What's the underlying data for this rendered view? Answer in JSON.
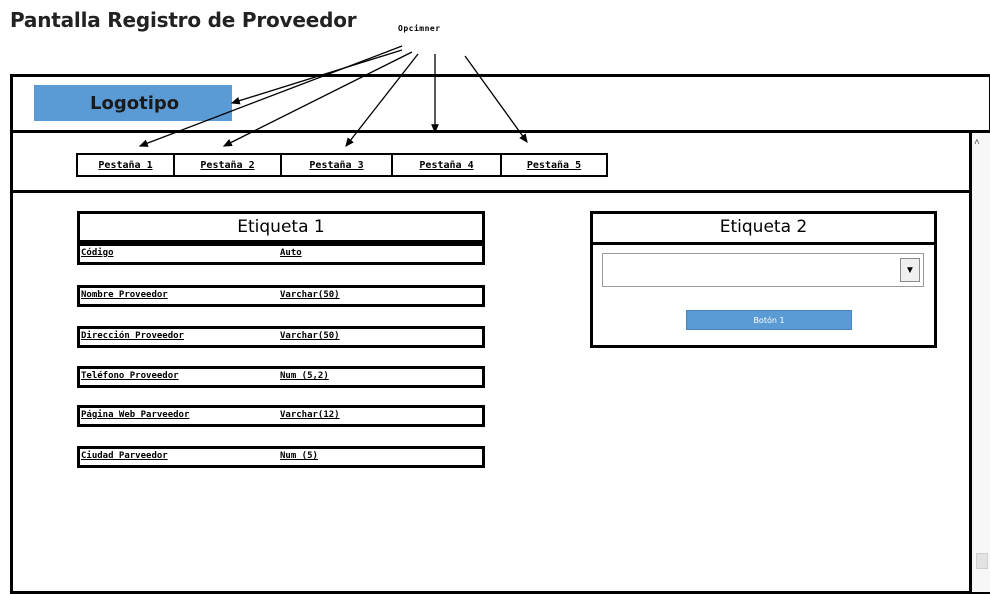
{
  "page_title": "Pantalla Registro de Proveedor",
  "annotation": "Opcimner",
  "logo": "Logotipo",
  "tabs": [
    "Pestaña 1",
    "Pestaña 2",
    "Pestaña 3",
    "Pestaña 4",
    "Pestaña 5"
  ],
  "etiqueta1": {
    "title": "Etiqueta 1",
    "fields": [
      {
        "name": "Código",
        "type": "Auto"
      },
      {
        "name": "Nombre Proveedor",
        "type": "Varchar(50)"
      },
      {
        "name": "Dirección Proveedor",
        "type": "Varchar(50)"
      },
      {
        "name": "Teléfono Proveedor",
        "type": "Num (5,2)"
      },
      {
        "name": "Página Web Parveedor",
        "type": "Varchar(12)"
      },
      {
        "name": "Ciudad Parveedor",
        "type": "Num (5)"
      }
    ]
  },
  "etiqueta2": {
    "title": "Etiqueta 2",
    "dropdown_value": "",
    "button": "Botón 1"
  },
  "colors": {
    "accent": "#5b9bd5",
    "border": "#000000"
  }
}
